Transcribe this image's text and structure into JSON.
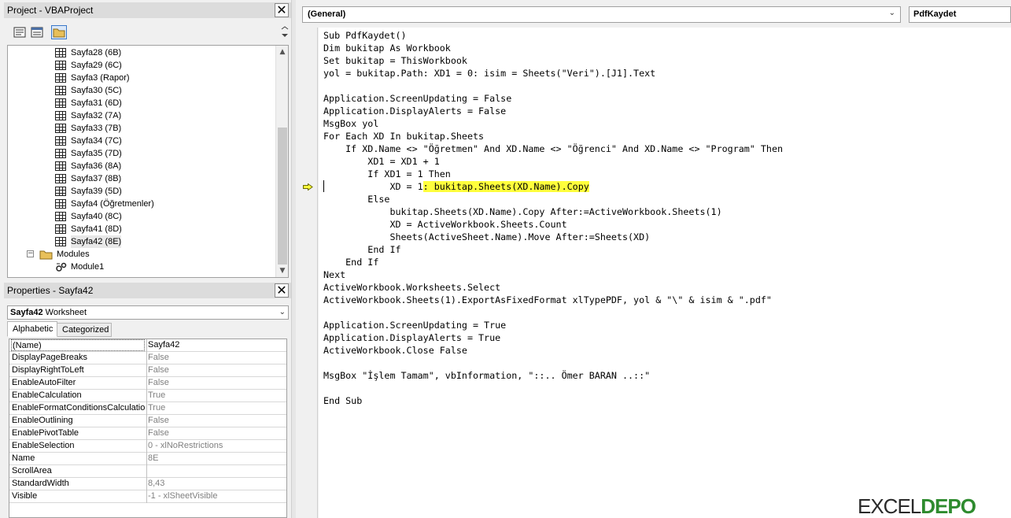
{
  "project_pane": {
    "title": "Project - VBAProject",
    "tree": [
      {
        "label": "Sayfa28 (6B)",
        "selected": false
      },
      {
        "label": "Sayfa29 (6C)",
        "selected": false
      },
      {
        "label": "Sayfa3 (Rapor)",
        "selected": false
      },
      {
        "label": "Sayfa30 (5C)",
        "selected": false
      },
      {
        "label": "Sayfa31 (6D)",
        "selected": false
      },
      {
        "label": "Sayfa32 (7A)",
        "selected": false
      },
      {
        "label": "Sayfa33 (7B)",
        "selected": false
      },
      {
        "label": "Sayfa34 (7C)",
        "selected": false
      },
      {
        "label": "Sayfa35 (7D)",
        "selected": false
      },
      {
        "label": "Sayfa36 (8A)",
        "selected": false
      },
      {
        "label": "Sayfa37 (8B)",
        "selected": false
      },
      {
        "label": "Sayfa39 (5D)",
        "selected": false
      },
      {
        "label": "Sayfa4 (Öğretmenler)",
        "selected": false
      },
      {
        "label": "Sayfa40 (8C)",
        "selected": false
      },
      {
        "label": "Sayfa41 (8D)",
        "selected": false
      },
      {
        "label": "Sayfa42 (8E)",
        "selected": true
      }
    ],
    "modules_folder": "Modules",
    "module": "Module1"
  },
  "properties_pane": {
    "title": "Properties - Sayfa42",
    "object_name": "Sayfa42",
    "object_type": "Worksheet",
    "tabs": [
      "Alphabetic",
      "Categorized"
    ],
    "active_tab": "Alphabetic",
    "rows": [
      {
        "name": "(Name)",
        "value": "Sayfa42",
        "dark": true
      },
      {
        "name": "DisplayPageBreaks",
        "value": "False",
        "dark": false
      },
      {
        "name": "DisplayRightToLeft",
        "value": "False",
        "dark": false
      },
      {
        "name": "EnableAutoFilter",
        "value": "False",
        "dark": false
      },
      {
        "name": "EnableCalculation",
        "value": "True",
        "dark": false
      },
      {
        "name": "EnableFormatConditionsCalculation",
        "value": "True",
        "dark": false
      },
      {
        "name": "EnableOutlining",
        "value": "False",
        "dark": false
      },
      {
        "name": "EnablePivotTable",
        "value": "False",
        "dark": false
      },
      {
        "name": "EnableSelection",
        "value": "0 - xlNoRestrictions",
        "dark": false
      },
      {
        "name": "Name",
        "value": "8E",
        "dark": false
      },
      {
        "name": "ScrollArea",
        "value": "",
        "dark": false
      },
      {
        "name": "StandardWidth",
        "value": "8,43",
        "dark": false
      },
      {
        "name": "Visible",
        "value": "-1 - xlSheetVisible",
        "dark": false
      }
    ]
  },
  "code_window": {
    "object_combo": "(General)",
    "procedure_combo": "PdfKaydet",
    "lines": [
      "Sub PdfKaydet()",
      "Dim bukitap As Workbook",
      "Set bukitap = ThisWorkbook",
      "yol = bukitap.Path: XD1 = 0: isim = Sheets(\"Veri\").[J1].Text",
      "",
      "Application.ScreenUpdating = False",
      "Application.DisplayAlerts = False",
      "MsgBox yol",
      "For Each XD In bukitap.Sheets",
      "    If XD.Name <> \"Öğretmen\" And XD.Name <> \"Öğrenci\" And XD.Name <> \"Program\" Then",
      "        XD1 = XD1 + 1",
      "        If XD1 = 1 Then",
      "            XD = 1: bukitap.Sheets(XD.Name).Copy",
      "        Else",
      "            bukitap.Sheets(XD.Name).Copy After:=ActiveWorkbook.Sheets(1)",
      "            XD = ActiveWorkbook.Sheets.Count",
      "            Sheets(ActiveSheet.Name).Move After:=Sheets(XD)",
      "        End If",
      "    End If",
      "Next",
      "ActiveWorkbook.Worksheets.Select",
      "ActiveWorkbook.Sheets(1).ExportAsFixedFormat xlTypePDF, yol & \"\\\" & isim & \".pdf\"",
      "",
      "Application.ScreenUpdating = True",
      "Application.DisplayAlerts = True",
      "ActiveWorkbook.Close False",
      "",
      "MsgBox \"İşlem Tamam\", vbInformation, \"::.. Ömer BARAN ..::\"",
      "",
      "End Sub"
    ],
    "execution_line_index": 12,
    "highlight_text": ": bukitap.Sheets(XD.Name).Copy",
    "highlight_color": "#ffff3c"
  },
  "watermark": {
    "part1": "EXCEL",
    "part2": "DEPO"
  }
}
